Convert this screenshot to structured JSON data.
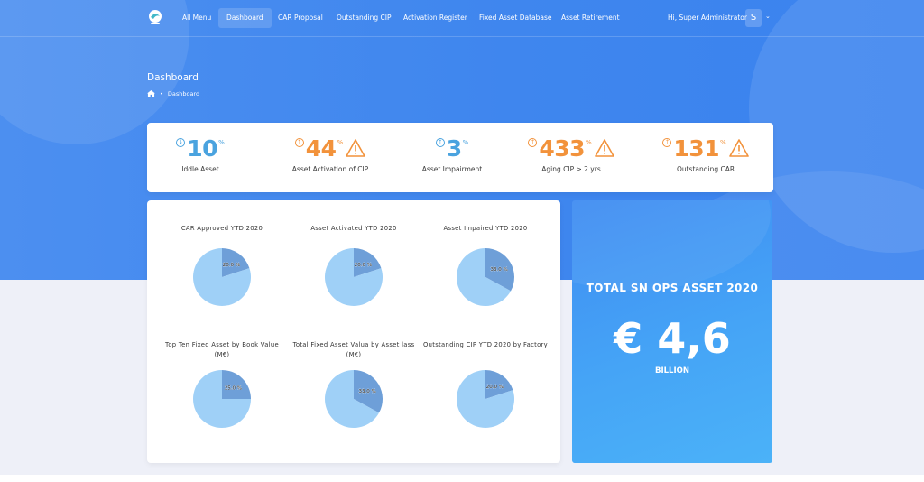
{
  "nav": {
    "items": [
      {
        "label": "All Menu",
        "active": false
      },
      {
        "label": "Dashboard",
        "active": true
      },
      {
        "label": "CAR Proposal",
        "active": false
      },
      {
        "label": "Outstanding CIP",
        "active": false
      },
      {
        "label": "Activation Register",
        "active": false
      },
      {
        "label": "Fixed Asset Database",
        "active": false
      },
      {
        "label": "Asset Retirement",
        "active": false
      }
    ],
    "greeting": "Hi, Super Administrator",
    "avatar_initial": "S"
  },
  "page": {
    "title": "Dashboard",
    "breadcrumb": "Dashboard"
  },
  "stats": [
    {
      "value": "10",
      "unit": "%",
      "label": "Iddle Asset",
      "color": "#4aa3df",
      "direction": "down",
      "warning": false
    },
    {
      "value": "44",
      "unit": "%",
      "label": "Asset Activation of CIP",
      "color": "#f2923b",
      "direction": "up",
      "warning": true
    },
    {
      "value": "3",
      "unit": "%",
      "label": "Asset Impairment",
      "color": "#4aa3df",
      "direction": "up",
      "warning": false
    },
    {
      "value": "433",
      "unit": "%",
      "label": "Aging CIP > 2 yrs",
      "color": "#f2923b",
      "direction": "up",
      "warning": true
    },
    {
      "value": "131",
      "unit": "%",
      "label": "Outstanding CAR",
      "color": "#f2923b",
      "direction": "up",
      "warning": true
    }
  ],
  "chart_data": [
    {
      "type": "pie",
      "title": "CAR Approved YTD 2020",
      "slices": [
        {
          "value": 20.0,
          "label": "20.0 %"
        },
        {
          "value": 80.0,
          "label": ""
        }
      ]
    },
    {
      "type": "pie",
      "title": "Asset Activated YTD 2020",
      "slices": [
        {
          "value": 20.0,
          "label": "20.0 %"
        },
        {
          "value": 80.0,
          "label": ""
        }
      ]
    },
    {
      "type": "pie",
      "title": "Asset Impaired YTD 2020",
      "slices": [
        {
          "value": 33.0,
          "label": "33.0 %"
        },
        {
          "value": 67.0,
          "label": ""
        }
      ]
    },
    {
      "type": "pie",
      "title": "Top Ten Fixed Asset by Book Value (M€)",
      "slices": [
        {
          "value": 25.0,
          "label": "25.0 %"
        },
        {
          "value": 75.0,
          "label": ""
        }
      ]
    },
    {
      "type": "pie",
      "title": "Total Fixed Asset Valua by Asset lass (M€)",
      "slices": [
        {
          "value": 33.0,
          "label": "33.0 %"
        },
        {
          "value": 67.0,
          "label": ""
        }
      ]
    },
    {
      "type": "pie",
      "title": "Outstanding CIP YTD 2020 by Factory",
      "slices": [
        {
          "value": 20.0,
          "label": "20.0 %"
        },
        {
          "value": 80.0,
          "label": ""
        }
      ]
    }
  ],
  "chart_colors": {
    "highlight": "#6e9fd8",
    "base": "#9fd0f7"
  },
  "total": {
    "title": "TOTAL SN OPS ASSET 2020",
    "value": "€ 4,6",
    "unit": "BILLION"
  }
}
